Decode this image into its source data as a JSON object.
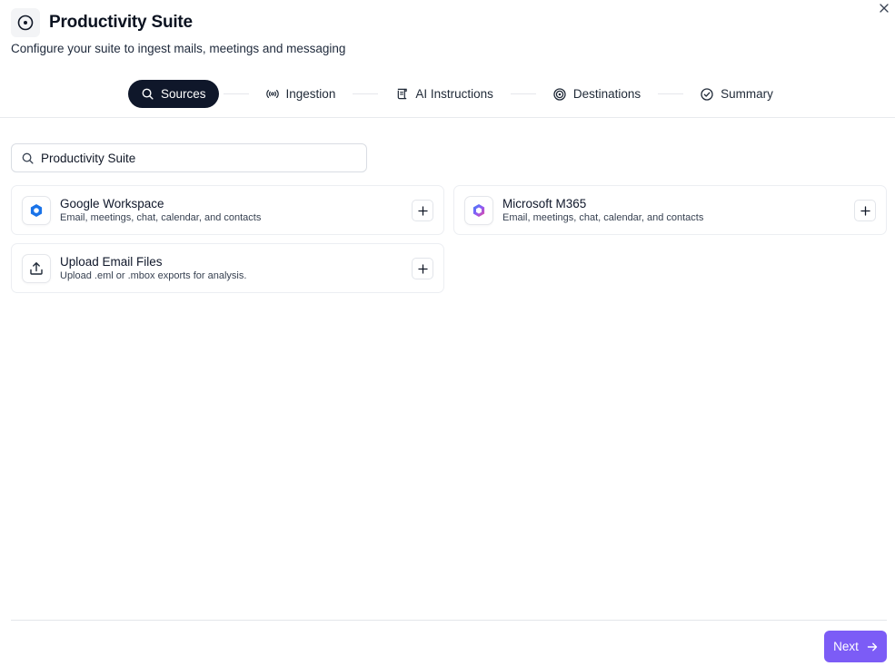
{
  "header": {
    "title": "Productivity Suite",
    "subtitle": "Configure your suite to ingest mails, meetings and messaging",
    "icon": "target-icon"
  },
  "stepper": {
    "steps": [
      {
        "label": "Sources",
        "icon": "search-icon",
        "active": true
      },
      {
        "label": "Ingestion",
        "icon": "broadcast-icon",
        "active": false
      },
      {
        "label": "AI Instructions",
        "icon": "scroll-icon",
        "active": false
      },
      {
        "label": "Destinations",
        "icon": "target-icon",
        "active": false
      },
      {
        "label": "Summary",
        "icon": "check-circle-icon",
        "active": false
      }
    ]
  },
  "search": {
    "value": "Productivity Suite",
    "icon": "search-icon"
  },
  "sources": [
    {
      "name": "Google Workspace",
      "description": "Email, meetings, chat, calendar, and contacts",
      "icon": "google-workspace-logo"
    },
    {
      "name": "Microsoft M365",
      "description": "Email, meetings, chat, calendar, and contacts",
      "icon": "microsoft-365-logo"
    },
    {
      "name": "Upload Email Files",
      "description": "Upload .eml or .mbox exports for analysis.",
      "icon": "upload-icon"
    }
  ],
  "footer": {
    "next_label": "Next"
  },
  "colors": {
    "active_step_bg": "#0f172a",
    "primary_button": "#7c5cf6",
    "google_blue": "#1a73e8"
  }
}
